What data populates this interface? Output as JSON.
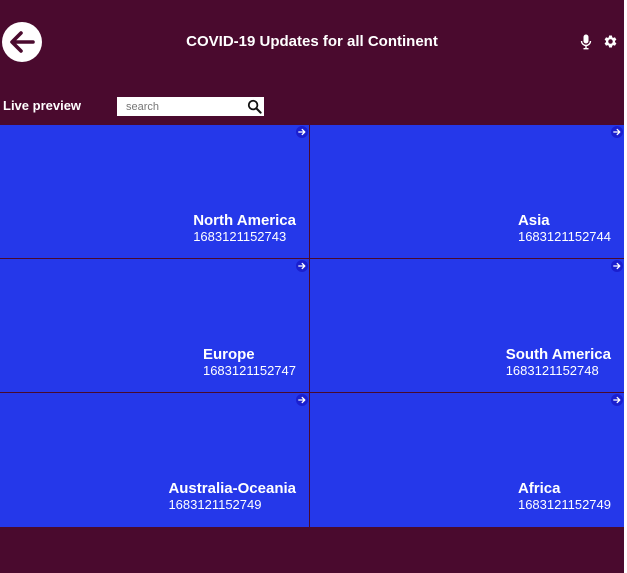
{
  "header": {
    "title": "COVID-19 Updates for all Continent",
    "back_icon": "arrow-left-icon",
    "mic_icon": "microphone-icon",
    "settings_icon": "gear-icon"
  },
  "toolbar": {
    "live_preview_label": "Live preview",
    "search": {
      "placeholder": "search",
      "value": ""
    }
  },
  "continents": [
    {
      "name": "North America",
      "value": "1683121152743"
    },
    {
      "name": "Asia",
      "value": "1683121152744"
    },
    {
      "name": "Europe",
      "value": "1683121152747"
    },
    {
      "name": "South America",
      "value": "1683121152748"
    },
    {
      "name": "Australia-Oceania",
      "value": "1683121152749"
    },
    {
      "name": "Africa",
      "value": "1683121152749"
    }
  ],
  "colors": {
    "background": "#4a0a2e",
    "card": "#2538ea",
    "text": "#ffffff"
  }
}
